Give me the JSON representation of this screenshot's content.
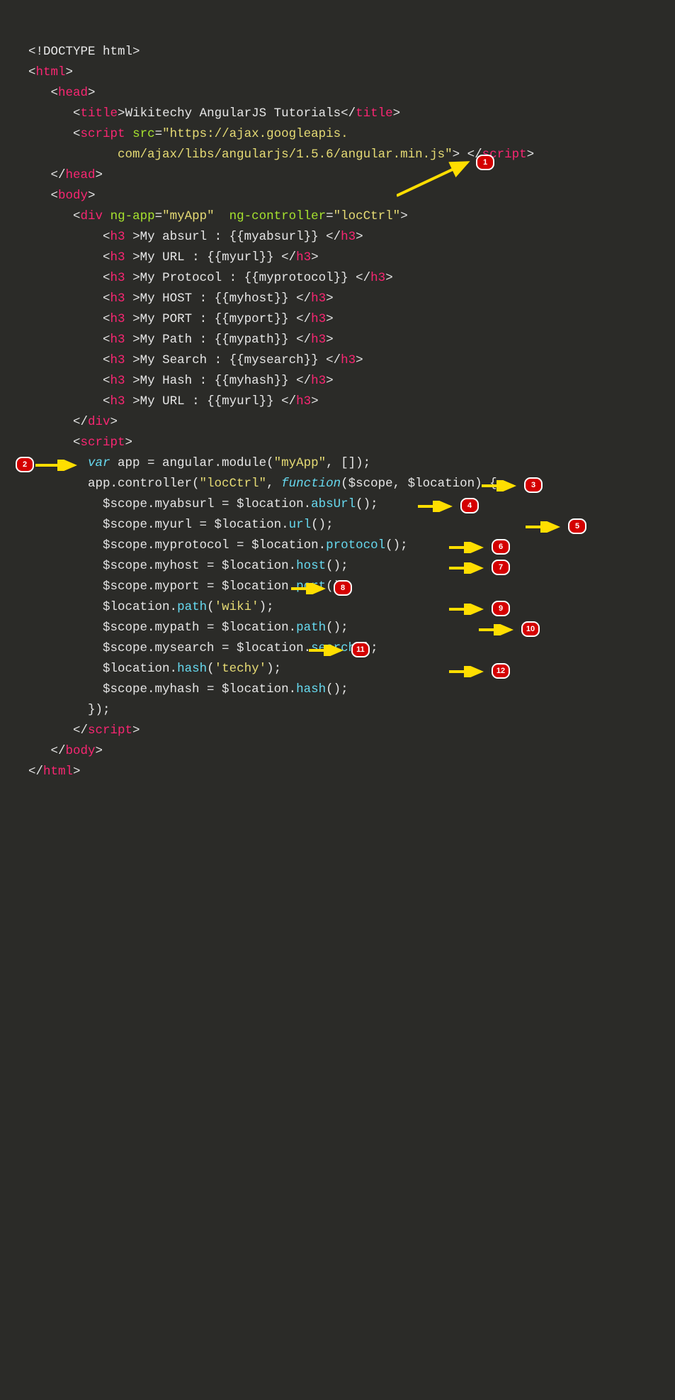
{
  "colors": {
    "bg": "#2b2b28",
    "tag": "#f92672",
    "attr": "#a6e22e",
    "string": "#e6db74",
    "keyword": "#66d9ef",
    "text": "#e6e6e6",
    "badge_bg": "#d40000",
    "arrow": "#ffde00"
  },
  "code": {
    "l01_doctype": "<!DOCTYPE html>",
    "l02_html_open": "html",
    "l03_head_open": "head",
    "l04_title_open": "title",
    "l04_title_text": "Wikitechy AngularJS Tutorials",
    "l04_title_close": "title",
    "l05_script_open": "script",
    "l05_src_attr": "src",
    "l05_src_val1": "\"https://ajax.googleapis.",
    "l06_src_val2": "com/ajax/libs/angularjs/1.5.6/angular.min.js\"",
    "l06_script_close": "script",
    "l07_head_close": "head",
    "l08_body_open": "body",
    "l09_div": "div",
    "l09_ngapp_attr": "ng-app",
    "l09_ngapp_val": "\"myApp\"",
    "l09_ngctrl_attr": "ng-controller",
    "l09_ngctrl_val": "\"locCtrl\"",
    "h3_01": "My absurl : {{myabsurl}} ",
    "h3_02": "My URL : {{myurl}} ",
    "h3_03": "My Protocol : {{myprotocol}} ",
    "h3_04": "My HOST : {{myhost}} ",
    "h3_05": "My PORT : {{myport}} ",
    "h3_06": "My Path : {{mypath}} ",
    "h3_07": "My Search : {{mysearch}} ",
    "h3_08": "My Hash : {{myhash}} ",
    "h3_09": "My URL : {{myurl}} ",
    "h3_tag": "h3",
    "l19_div_close": "div",
    "l20_script_open": "script",
    "l21_var": "var",
    "l21_rest": " app = angular.module(",
    "l21_str": "\"myApp\"",
    "l21_end": ", []);",
    "l22_a": "app.controller(",
    "l22_str": "\"locCtrl\"",
    "l22_b": ", ",
    "l22_fn": "function",
    "l22_c": "($scope, $location) {",
    "l23_a": "$scope.myabsurl = $location.",
    "l23_m": "absUrl",
    "l23_e": "();",
    "l24_a": "$scope.myurl = $location.",
    "l24_m": "url",
    "l24_e": "();",
    "l25_a": "$scope.myprotocol = $location.",
    "l25_m": "protocol",
    "l25_e": "();",
    "l26_a": "$scope.myhost = $location.",
    "l26_m": "host",
    "l26_e": "();",
    "l27_a": "$scope.myport = $location.",
    "l27_m": "port",
    "l27_e": "();",
    "l28_a": "$location.",
    "l28_m": "path",
    "l28_b": "(",
    "l28_s": "'wiki'",
    "l28_e": ");",
    "l29_a": "$scope.mypath = $location.",
    "l29_m": "path",
    "l29_e": "();",
    "l30_a": "$scope.mysearch = $location.",
    "l30_m": "search",
    "l30_e": "();",
    "l31_a": "$location.",
    "l31_m": "hash",
    "l31_b": "(",
    "l31_s": "'techy'",
    "l31_e": ");",
    "l32_a": "$scope.myhash = $location.",
    "l32_m": "hash",
    "l32_e": "();",
    "l33": "});",
    "l34_script_close": "script",
    "l35_body_close": "body",
    "l36_html_close": "html"
  },
  "badges": {
    "b1": "1",
    "b2": "2",
    "b3": "3",
    "b4": "4",
    "b5": "5",
    "b6": "6",
    "b7": "7",
    "b8": "8",
    "b9": "9",
    "b10": "10",
    "b11": "11",
    "b12": "12"
  }
}
